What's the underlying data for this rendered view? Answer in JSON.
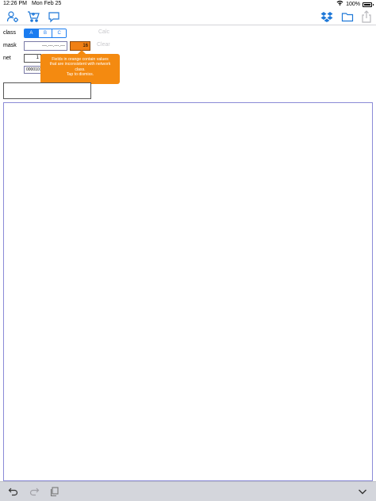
{
  "status_bar": {
    "time": "12:26 PM",
    "date": "Mon Feb 25",
    "battery_percent": "100%"
  },
  "toolbar": {
    "icons": [
      "person-settings-icon",
      "cart-icon",
      "chat-bubble-icon",
      "dropbox-icon",
      "folder-icon",
      "share-icon"
    ]
  },
  "form": {
    "class_label": "class",
    "class_options": [
      "A",
      "B",
      "C"
    ],
    "class_selected": "A",
    "mask_label": "mask",
    "mask_value": "---.---.---.---",
    "prefix_value": "16",
    "net_label": "net",
    "net_value": "1",
    "binary_value": "00001010",
    "calc_label": "Calc",
    "clear_label": "Clear"
  },
  "tooltip": {
    "line1": "Fields in orange contain values",
    "line2": "that are inconsistent with network",
    "line3": "class.",
    "line4": "Tap to dismiss."
  },
  "colors": {
    "accent": "#1a7cf0",
    "warning": "#f48a10",
    "disabled": "#c8c8cc"
  },
  "bottom_bar": {
    "icons": [
      "undo-icon",
      "redo-icon",
      "copy-icon",
      "chevron-down-icon"
    ]
  }
}
